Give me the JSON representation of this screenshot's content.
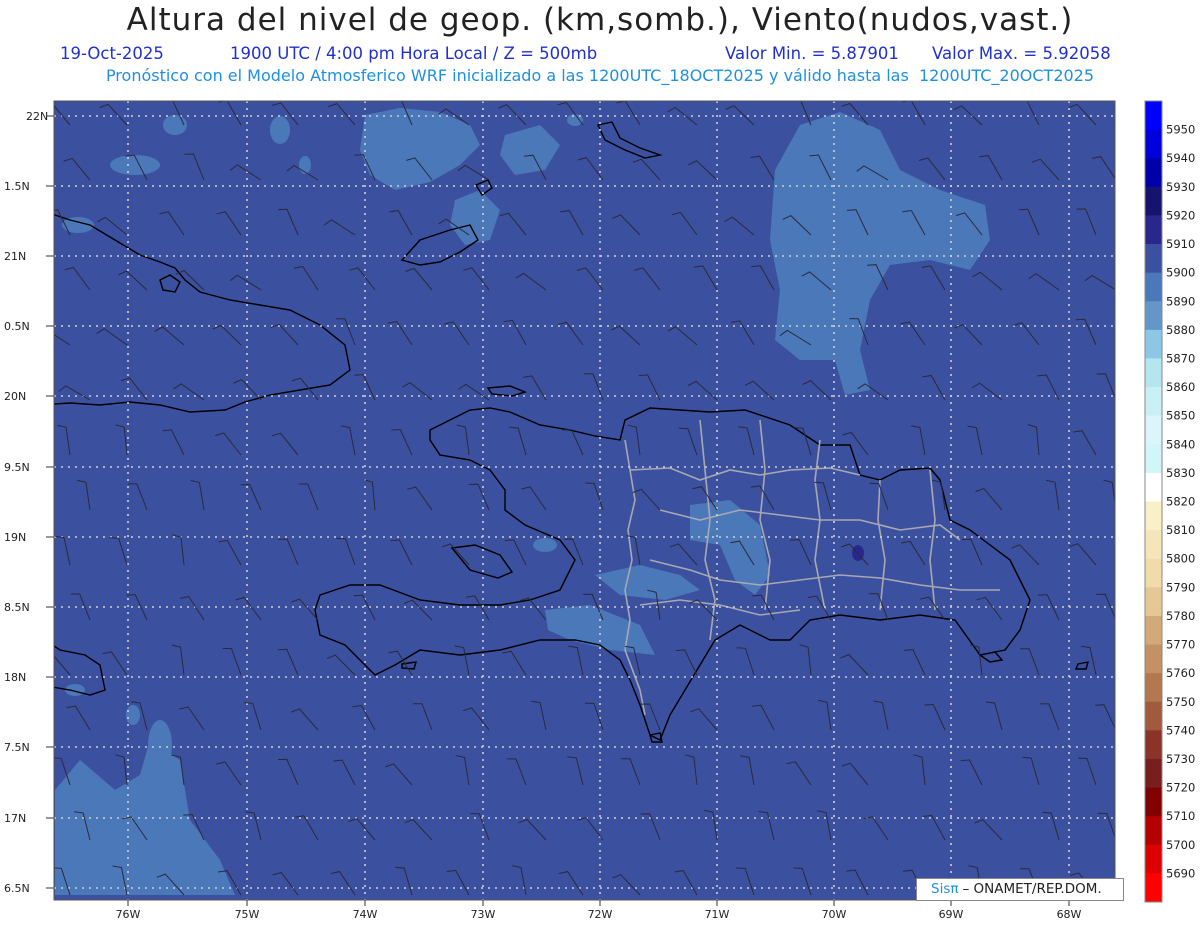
{
  "title": "Altura del nivel de geop. (km,somb.), Viento(nudos,vast.)",
  "subtitle": {
    "date": "19-Oct-2025",
    "time": "1900 UTC / 4:00 pm Hora Local / Z = 500mb",
    "min": "Valor Min. = 5.87901",
    "max": "Valor Max. = 5.92058"
  },
  "model_line": "Pronóstico con el Modelo Atmosferico WRF inicializado a las 1200UTC_18OCT2025 y válido hasta las  1200UTC_20OCT2025",
  "lat_labels": [
    "22N",
    "1.5N",
    "21N",
    "0.5N",
    "20N",
    "9.5N",
    "19N",
    "8.5N",
    "18N",
    "7.5N",
    "17N",
    "6.5N"
  ],
  "lon_labels": [
    "76W",
    "75W",
    "74W",
    "73W",
    "72W",
    "71W",
    "70W",
    "69W",
    "68W"
  ],
  "colorbar": {
    "labels": [
      "5950",
      "5940",
      "5930",
      "5920",
      "5910",
      "5900",
      "5890",
      "5880",
      "5870",
      "5860",
      "5850",
      "5840",
      "5830",
      "5820",
      "5810",
      "5800",
      "5790",
      "5780",
      "5770",
      "5760",
      "5750",
      "5740",
      "5730",
      "5720",
      "5710",
      "5700",
      "5690"
    ],
    "colors": [
      "#0000ff",
      "#0000dd",
      "#0000aa",
      "#14146e",
      "#28288c",
      "#3c50a0",
      "#4b78b9",
      "#6496c8",
      "#8cc8e6",
      "#b4e6f0",
      "#c8f0f5",
      "#dcf5fa",
      "#d2f5fa",
      "#ffffff",
      "#faf0c8",
      "#f5e6b9",
      "#f0dcaa",
      "#e6c896",
      "#d2aa78",
      "#c39164",
      "#b47850",
      "#a05a3c",
      "#8c3228",
      "#781e1e",
      "#820000",
      "#b40000",
      "#dc0000",
      "#ff0000"
    ]
  },
  "footer": {
    "brand": "Sisπ",
    "org": "– ONAMET/REP.DOM."
  }
}
